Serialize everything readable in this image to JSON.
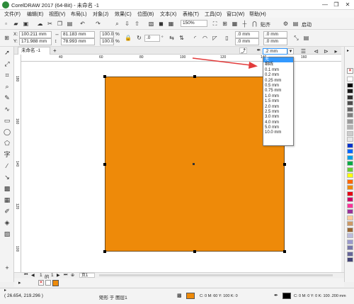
{
  "titlebar": {
    "title": "CorelDRAW 2017 (64-Bit) - 未命名 -1",
    "minimize": "—",
    "restore": "❐",
    "close": "✕"
  },
  "menubar": [
    "文件(F)",
    "编辑(E)",
    "视图(V)",
    "布局(L)",
    "对象(J)",
    "效果(C)",
    "位图(B)",
    "文本(X)",
    "表格(T)",
    "工具(O)",
    "窗口(W)",
    "帮助(H)"
  ],
  "standard_bar": {
    "zoom": "150%",
    "snap_label": "贴齐",
    "launch_label": "启动"
  },
  "property_bar": {
    "x_label": "X:",
    "x_value": "100.211 mm",
    "y_label": "Y:",
    "y_value": "171.988 mm",
    "w_value": "81.183 mm",
    "h_value": "78.993 mm",
    "sx_value": "100.0",
    "sy_value": "100.0",
    "pct": "%",
    "angle_value": ".0",
    "angle_unit": "°",
    "corner1": ".0 mm",
    "corner2": ".0 mm",
    "corner3": ".0 mm",
    "corner4": ".0 mm",
    "outline_width": ".2 mm"
  },
  "document_tab": {
    "label": "未命名 -1",
    "plus": "+"
  },
  "outline_width_options": [
    "无",
    "细线",
    "0.1 mm",
    "0.2 mm",
    "0.25 mm",
    "0.5 mm",
    "0.75 mm",
    "1.0 mm",
    "1.5 mm",
    "2.0 mm",
    "2.5 mm",
    "3.0 mm",
    "4.0 mm",
    "5.0 mm",
    "10.0 mm"
  ],
  "outline_width_selected_index": 0,
  "ruler_h_labels": [
    "40",
    "60",
    "80",
    "100",
    "120",
    "140",
    "160"
  ],
  "ruler_v_labels": [
    "180",
    "160",
    "140",
    "120",
    "100"
  ],
  "page_nav": {
    "current": "1",
    "of": "的",
    "total": "1",
    "page_tab": "页1"
  },
  "status": {
    "coords": "( 26.654, 219.296 )",
    "selection": "矩形 于 图层1",
    "fill_info": "C: 0 M: 60 Y: 100 K: 0",
    "outline_info": "C: 0 M: 0 Y: 0 K: 100 .200 mm"
  },
  "colors": {
    "accent_orange": "#ee8a09",
    "selection_blue": "#3399ff",
    "arrow_red": "#e23b3b"
  },
  "palette_colors": [
    "#ffffff",
    "#000000",
    "#1a1a1a",
    "#333333",
    "#4d4d4d",
    "#666666",
    "#808080",
    "#999999",
    "#b3b3b3",
    "#cccccc",
    "#e6e6e6",
    "#0033cc",
    "#0066ff",
    "#00a0e9",
    "#00aa44",
    "#66cc33",
    "#ffff00",
    "#ff6600",
    "#ee8a09",
    "#e60012",
    "#cc0066",
    "#ff3399",
    "#993399",
    "#ffcc99",
    "#cc9966",
    "#996633",
    "#bbbbdd",
    "#9999cc",
    "#7777aa",
    "#666699",
    "#444477"
  ]
}
